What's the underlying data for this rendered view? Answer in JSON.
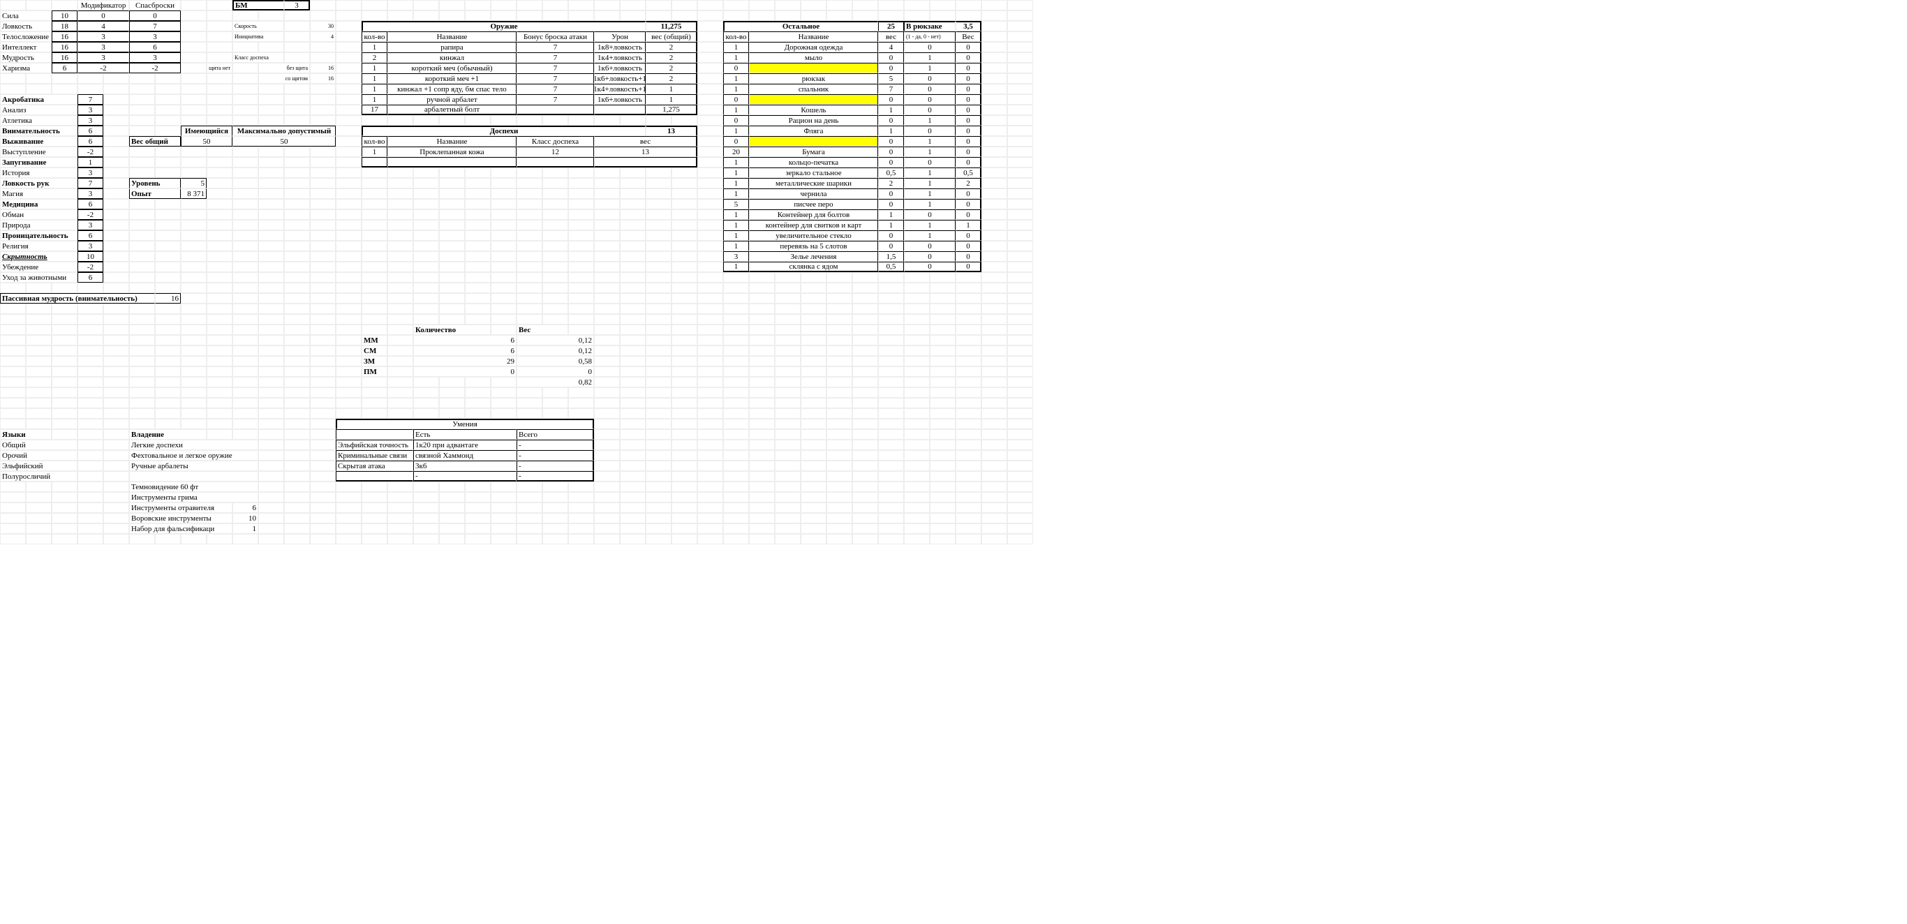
{
  "hdr": {
    "mod": "Модификатор",
    "save": "Спасброски",
    "bm": "БМ",
    "bmv": "3"
  },
  "ab": [
    [
      "Сила",
      "10",
      "0",
      "0"
    ],
    [
      "Ловкость",
      "18",
      "4",
      "7"
    ],
    [
      "Телосложение",
      "16",
      "3",
      "3"
    ],
    [
      "Интеллект",
      "16",
      "3",
      "6"
    ],
    [
      "Мудрость",
      "16",
      "3",
      "3"
    ],
    [
      "Харизма",
      "6",
      "-2",
      "-2"
    ]
  ],
  "stats": {
    "speed_l": "Скорость",
    "speed": "30",
    "init_l": "Инициатива",
    "init": "4",
    "ac_l": "Класс доспеха",
    "ns_l": "без щита",
    "ns": "16",
    "sh_l": "со щитом",
    "sh": "16",
    "nsh_l": "щита нет"
  },
  "skills": [
    [
      "Акробатика",
      "7",
      1
    ],
    [
      "Анализ",
      "3",
      0
    ],
    [
      "Атлетика",
      "3",
      0
    ],
    [
      "Внимательность",
      "6",
      1
    ],
    [
      "Выживание",
      "6",
      1
    ],
    [
      "Выступление",
      "-2",
      0
    ],
    [
      "Запугивание",
      "1",
      1
    ],
    [
      "История",
      "3",
      0
    ],
    [
      "Ловкость рук",
      "7",
      1
    ],
    [
      "Магия",
      "3",
      0
    ],
    [
      "Медицина",
      "6",
      1
    ],
    [
      "Обман",
      "-2",
      0
    ],
    [
      "Природа",
      "3",
      0
    ],
    [
      "Проницательность",
      "6",
      1
    ],
    [
      "Религия",
      "3",
      0
    ],
    [
      "Скрытность",
      "10",
      2
    ],
    [
      "Убеждение",
      "-2",
      0
    ],
    [
      "Уход за животными",
      "6",
      0
    ]
  ],
  "wt": {
    "cur_l": "Имеющийся",
    "max_l": "Максимально допустимый",
    "tot_l": "Вес общий",
    "cur": "50",
    "max": "50"
  },
  "lvl": {
    "l": "Уровень",
    "v": "5",
    "xp_l": "Опыт",
    "xp": "8 371"
  },
  "pp": {
    "l": "Пассивная мудрость (внимательность)",
    "v": "16"
  },
  "wTitle": "Оружие",
  "wTot": "11,275",
  "wH": [
    "кол-во",
    "Название",
    "Бонус броска атаки",
    "Урон",
    "вес (общий)"
  ],
  "weapons": [
    [
      "1",
      "рапира",
      "7",
      "1к8+ловкость",
      "2"
    ],
    [
      "2",
      "кинжал",
      "7",
      "1к4+ловкость",
      "2"
    ],
    [
      "1",
      "короткий меч (обычный)",
      "7",
      "1к6+ловкость",
      "2"
    ],
    [
      "1",
      "короткий меч +1",
      "7",
      "1к6+ловкость+1",
      "2"
    ],
    [
      "1",
      "кинжал +1 сопр яду, бм спас тело",
      "7",
      "1к4+ловкость+1",
      "1"
    ],
    [
      "1",
      "ручной арбалет",
      "7",
      "1к6+ловкость",
      "1"
    ],
    [
      "17",
      "арбалетный болт",
      "",
      "",
      "1,275"
    ]
  ],
  "aTitle": "Доспехи",
  "aTot": "13",
  "aH": [
    "кол-во",
    "Название",
    "Класс доспеха",
    "вес"
  ],
  "armor": [
    [
      "1",
      "Проклепанная кожа",
      "12",
      "13"
    ]
  ],
  "oTitle": "Остальное",
  "oTot": "25",
  "bp_l": "В рюкзаке",
  "bp": "3,5",
  "oH": [
    "кол-во",
    "Название",
    "вес",
    "(1 - да, 0 - нет)",
    "Вес"
  ],
  "items": [
    [
      "1",
      "Дорожная одежда",
      "4",
      "0",
      "0",
      0
    ],
    [
      "1",
      "мыло",
      "0",
      "1",
      "0",
      0
    ],
    [
      "0",
      "",
      "0",
      "1",
      "0",
      1
    ],
    [
      "1",
      "рюкзак",
      "5",
      "0",
      "0",
      0
    ],
    [
      "1",
      "спальник",
      "7",
      "0",
      "0",
      0
    ],
    [
      "0",
      "",
      "0",
      "0",
      "0",
      1
    ],
    [
      "1",
      "Кошель",
      "1",
      "0",
      "0",
      0
    ],
    [
      "0",
      "Рацион на день",
      "0",
      "1",
      "0",
      0
    ],
    [
      "1",
      "Фляга",
      "1",
      "0",
      "0",
      0
    ],
    [
      "0",
      "",
      "0",
      "1",
      "0",
      1
    ],
    [
      "20",
      "Бумага",
      "0",
      "1",
      "0",
      0
    ],
    [
      "1",
      "кольцо-печатка",
      "0",
      "0",
      "0",
      0
    ],
    [
      "1",
      "зеркало стальное",
      "0,5",
      "1",
      "0,5",
      0
    ],
    [
      "1",
      "металлические шарики",
      "2",
      "1",
      "2",
      0
    ],
    [
      "1",
      "чернила",
      "0",
      "1",
      "0",
      0
    ],
    [
      "5",
      "писчее перо",
      "0",
      "1",
      "0",
      0
    ],
    [
      "1",
      "Контейнер для болтов",
      "1",
      "0",
      "0",
      0
    ],
    [
      "1",
      "контейнер для свитков и карт",
      "1",
      "1",
      "1",
      0
    ],
    [
      "1",
      "увеличительное стекло",
      "0",
      "1",
      "0",
      0
    ],
    [
      "1",
      "перевязь на 5 слотов",
      "0",
      "0",
      "0",
      0
    ],
    [
      "3",
      "Зелье лечения",
      "1,5",
      "0",
      "0",
      0
    ],
    [
      "1",
      "склянка с ядом",
      "0,5",
      "0",
      "0",
      0
    ]
  ],
  "coinH": [
    "Количество",
    "Вес"
  ],
  "coins": [
    [
      "ММ",
      "6",
      "0,12"
    ],
    [
      "СМ",
      "6",
      "0,12"
    ],
    [
      "ЗМ",
      "29",
      "0,58"
    ],
    [
      "ПМ",
      "0",
      "0"
    ]
  ],
  "coinTot": "0,82",
  "skTitle": "Умения",
  "skH": [
    "Есть",
    "Всего"
  ],
  "skRows": [
    [
      "Эльфийская точность",
      "1к20 при адвантаге",
      "-"
    ],
    [
      "Криминальные связи",
      "связной Хаммонд",
      "-"
    ],
    [
      "Скрытая атака",
      "3к6",
      "-"
    ],
    [
      "",
      "-",
      "-"
    ]
  ],
  "lang": {
    "t": "Языки",
    "r": [
      "Общий",
      "Орочий",
      "Эльфийский",
      "Полуросличий"
    ]
  },
  "prof": {
    "t": "Владение",
    "r": [
      "Легкие доспехи",
      "Фехтовальное и легкое оружие",
      "Ручные арбалеты",
      "",
      "Темновидение 60 фт",
      "Инструменты грима",
      [
        "Инструменты отравителя",
        "6"
      ],
      [
        "Воровские инструменты",
        "10"
      ],
      [
        "Набор для фальсификаци",
        "1"
      ]
    ]
  }
}
